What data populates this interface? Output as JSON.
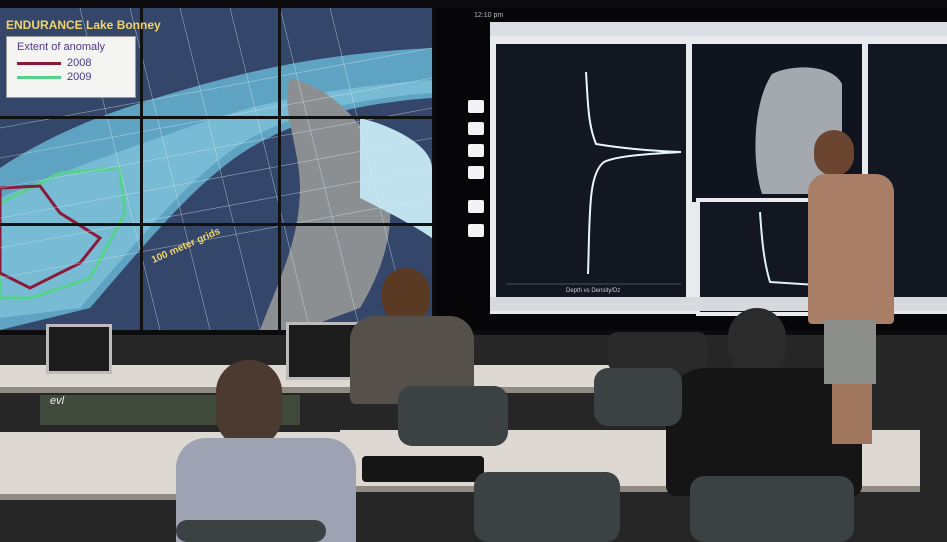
{
  "map_screen": {
    "title": "ENDURANCE Lake Bonney",
    "legend": {
      "title": "Extent of anomaly",
      "rows": [
        {
          "label": "2008",
          "color": "#8b1a3a"
        },
        {
          "label": "2009",
          "color": "#55d28a"
        }
      ]
    },
    "grid_label": "100 meter grids"
  },
  "data_screen": {
    "clock": "12:10 pm",
    "plot_caption": "Depth vs Density/Dz"
  },
  "room": {
    "logo_text": "evl"
  }
}
